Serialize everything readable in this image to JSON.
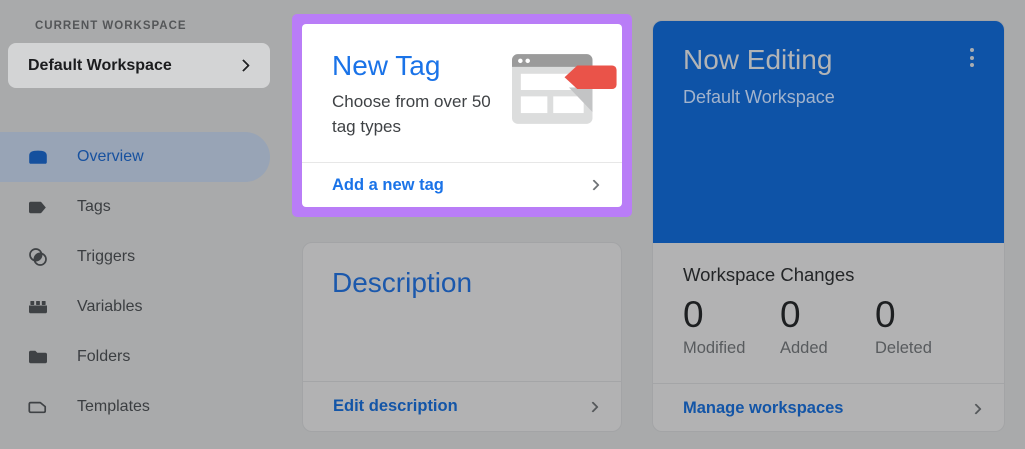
{
  "sidebar": {
    "section_label": "CURRENT WORKSPACE",
    "workspace_button_label": "Default Workspace",
    "items": [
      {
        "label": "Overview",
        "icon": "overview-icon",
        "selected": true
      },
      {
        "label": "Tags",
        "icon": "tag-icon",
        "selected": false
      },
      {
        "label": "Triggers",
        "icon": "triggers-icon",
        "selected": false
      },
      {
        "label": "Variables",
        "icon": "variables-icon",
        "selected": false
      },
      {
        "label": "Folders",
        "icon": "folder-icon",
        "selected": false
      },
      {
        "label": "Templates",
        "icon": "template-icon",
        "selected": false
      }
    ]
  },
  "new_tag_card": {
    "title": "New Tag",
    "subtitle": "Choose from over 50 tag types",
    "action_label": "Add a new tag",
    "icon": "browser-window-with-red-tag-icon"
  },
  "description_card": {
    "title": "Description",
    "action_label": "Edit description"
  },
  "now_editing_card": {
    "title": "Now Editing",
    "subtitle": "Default Workspace",
    "menu_icon": "kebab-menu-icon"
  },
  "workspace_changes_card": {
    "title": "Workspace Changes",
    "stats": [
      {
        "value": "0",
        "label": "Modified"
      },
      {
        "value": "0",
        "label": "Added"
      },
      {
        "value": "0",
        "label": "Deleted"
      }
    ],
    "action_label": "Manage workspaces"
  },
  "colors": {
    "page_dim_background": "#a9aaab",
    "spotlight_border_purple": "#b97df7",
    "link_blue": "#1a73e8",
    "dimmed_link_blue": "#1355a7",
    "now_editing_blue": "#0e53a7",
    "selected_nav_pill": "#98a4b6",
    "selected_nav_text": "#17519f",
    "tag_red": "#ea5349"
  }
}
